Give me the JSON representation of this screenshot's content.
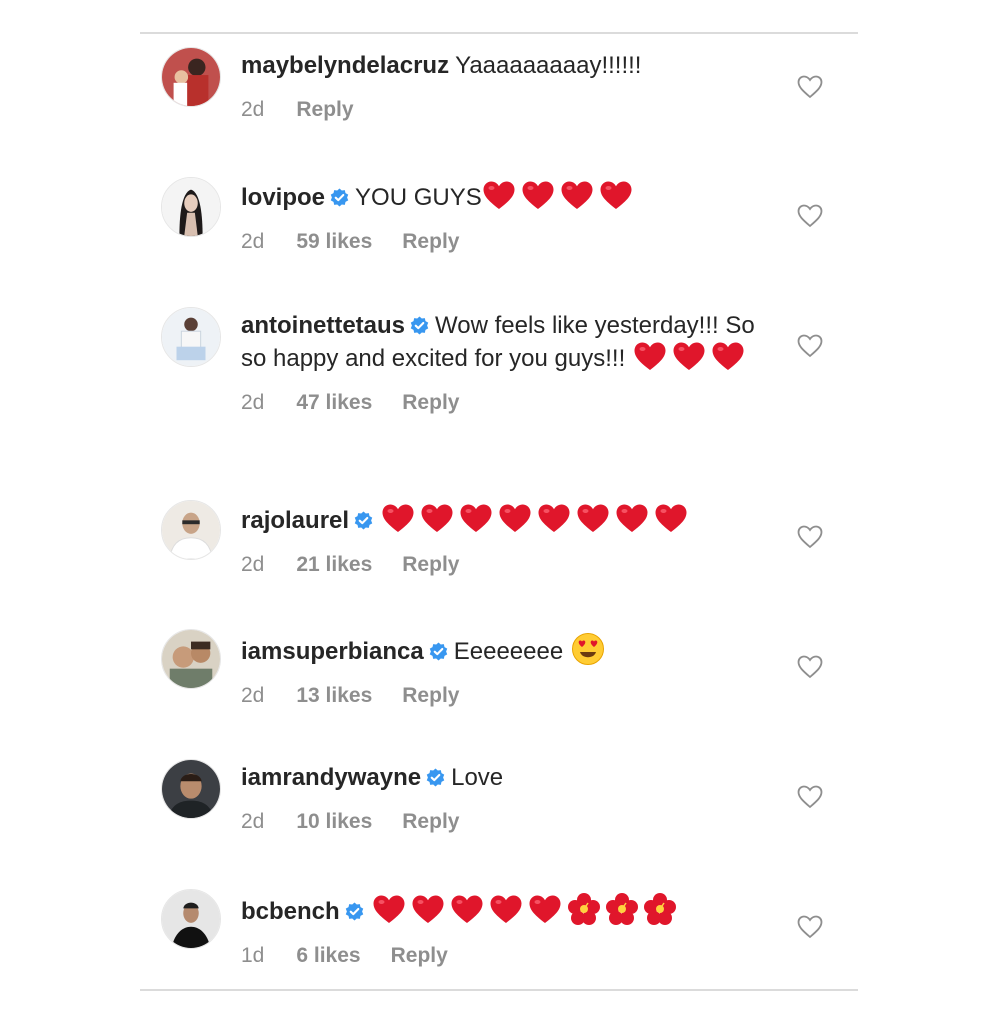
{
  "comments": [
    {
      "username": "maybelyndelacruz",
      "verified": false,
      "text": "Yaaaaaaaaay!!!!!!",
      "time": "2d",
      "likes": "",
      "reply": "Reply",
      "hearts": 0,
      "flowers": 0
    },
    {
      "username": "lovipoe",
      "verified": true,
      "text": "YOU GUYS",
      "time": "2d",
      "likes": "59 likes",
      "reply": "Reply",
      "hearts": 4,
      "flowers": 0
    },
    {
      "username": "antoinettetaus",
      "verified": true,
      "text": "Wow feels like yesterday!!! So so happy and excited for you guys!!!",
      "time": "2d",
      "likes": "47 likes",
      "reply": "Reply",
      "hearts": 3,
      "flowers": 0
    },
    {
      "username": "rajolaurel",
      "verified": true,
      "text": "",
      "time": "2d",
      "likes": "21 likes",
      "reply": "Reply",
      "hearts": 8,
      "flowers": 0
    },
    {
      "username": "iamsuperbianca",
      "verified": true,
      "text": "Eeeeeeee",
      "time": "2d",
      "likes": "13 likes",
      "reply": "Reply",
      "hearts": 0,
      "flowers": 0,
      "smile": true
    },
    {
      "username": "iamrandywayne",
      "verified": true,
      "text": "Love",
      "time": "2d",
      "likes": "10 likes",
      "reply": "Reply",
      "hearts": 0,
      "flowers": 0
    },
    {
      "username": "bcbench",
      "verified": true,
      "text": "",
      "time": "1d",
      "likes": "6 likes",
      "reply": "Reply",
      "hearts": 5,
      "flowers": 3
    }
  ],
  "colors": {
    "verified_badge": "#3897f0",
    "heart_emoji": "#e0162b",
    "muted_text": "#8e8e8e",
    "divider": "#dbdbdb"
  },
  "icons": {
    "like": "heart-outline-icon",
    "verified": "verified-badge-icon"
  }
}
